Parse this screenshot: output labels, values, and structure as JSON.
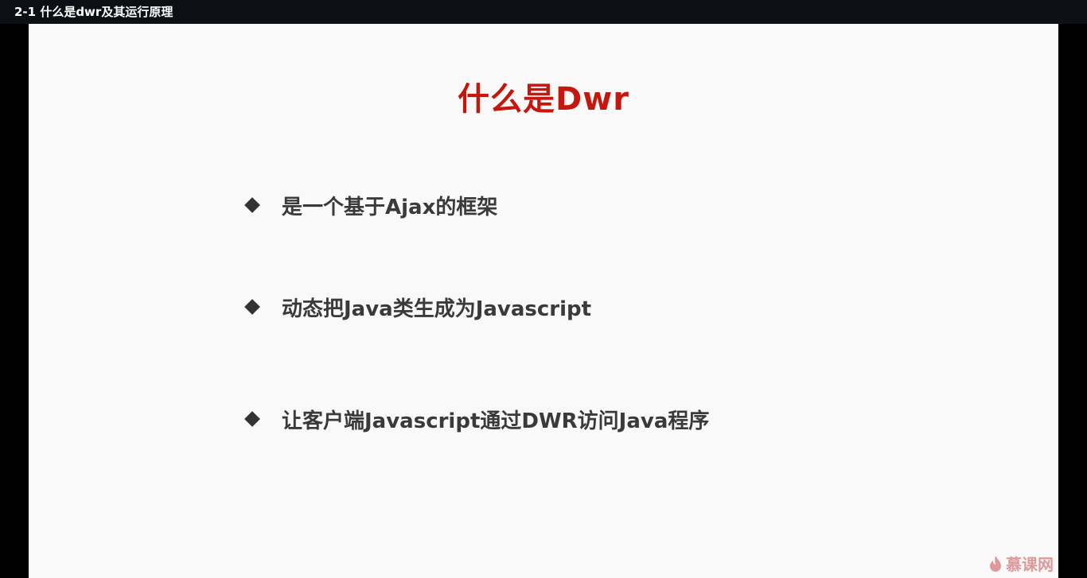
{
  "window": {
    "title": "2-1 什么是dwr及其运行原理"
  },
  "slide": {
    "title": "什么是Dwr",
    "bullets": [
      "是一个基于Ajax的框架",
      "动态把Java类生成为Javascript",
      "让客户端Javascript通过DWR访问Java程序"
    ]
  },
  "watermark": {
    "text": "慕课网",
    "icon": "flame-icon"
  },
  "colors": {
    "title_red": "#c4170e",
    "bullet_text": "#3a3a3a",
    "slide_background": "#f9f9f9"
  }
}
